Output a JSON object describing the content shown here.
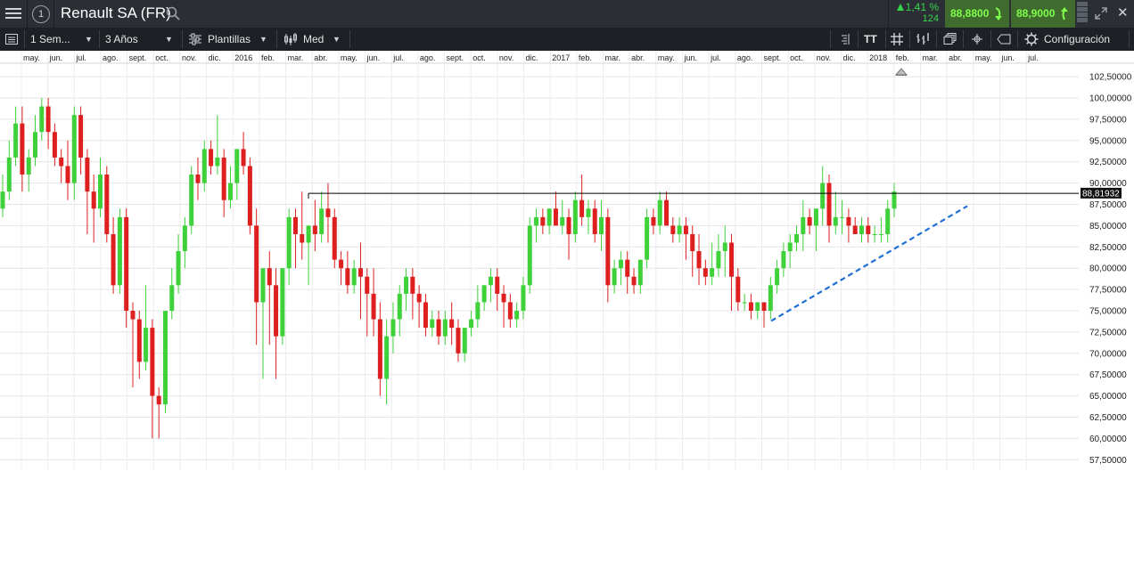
{
  "header": {
    "instrument_title": "Renault SA (FR)",
    "info_glyph": "1",
    "change_percent": "1,41 %",
    "change_count": "124",
    "sell_price": "88,8800",
    "buy_price": "88,9000",
    "icons": [
      "menu-icon",
      "info-icon",
      "search-icon",
      "arrow-down-icon",
      "arrow-up-icon",
      "market-depth-icon",
      "expand-icon",
      "close-icon"
    ]
  },
  "toolbar": {
    "interval": "1 Sem...",
    "range": "3 Años",
    "templates": "Plantillas",
    "chart_style": "Med",
    "settings": "Configuración",
    "text_tool": "TT",
    "icons": [
      "sidebar-icon",
      "templates-icon",
      "candles-icon",
      "indent-icon",
      "text-icon",
      "grid-icon",
      "bars-icon",
      "layers-icon",
      "crosshair-icon",
      "tag-icon",
      "gear-icon"
    ]
  },
  "colors": {
    "up": "#3fd13a",
    "down": "#dd1f1f",
    "trendline": "#1f6fd6",
    "header_bg": "#2b2f35",
    "toolbar_bg": "#1d2024",
    "price_green": "#7fff4a"
  },
  "chart_data": {
    "type": "candlestick",
    "interval": "weekly",
    "current_price_label": "88,81932",
    "current_price": 88.81932,
    "y_ticks": [
      "102,50000",
      "100,00000",
      "97,50000",
      "95,00000",
      "92,50000",
      "90,00000",
      "87,50000",
      "85,00000",
      "82,50000",
      "80,00000",
      "77,50000",
      "75,00000",
      "72,50000",
      "70,00000",
      "67,50000",
      "65,00000",
      "62,50000",
      "60,00000",
      "57,50000"
    ],
    "y_tick_values": [
      102.5,
      100,
      97.5,
      95,
      92.5,
      90,
      87.5,
      85,
      82.5,
      80,
      77.5,
      75,
      72.5,
      70,
      67.5,
      65,
      62.5,
      60,
      57.5
    ],
    "x_ticks": [
      "may.",
      "jun.",
      "jul.",
      "ago.",
      "sept.",
      "oct.",
      "nov.",
      "dic.",
      "2016",
      "feb.",
      "mar.",
      "abr.",
      "may.",
      "jun.",
      "jul.",
      "ago.",
      "sept.",
      "oct.",
      "nov.",
      "dic.",
      "2017",
      "feb.",
      "mar.",
      "abr.",
      "may.",
      "jun.",
      "jul.",
      "ago.",
      "sept.",
      "oct.",
      "nov.",
      "dic.",
      "2018",
      "feb.",
      "mar.",
      "abr.",
      "may.",
      "jun.",
      "jul."
    ],
    "resistance_level": 88.8,
    "trendline": {
      "from": {
        "date": "2017-08-21",
        "price": 73.8
      },
      "to": {
        "date": "2018-03-12",
        "price": 87.3
      }
    },
    "candles": [
      [
        87,
        91,
        86,
        89
      ],
      [
        89,
        95,
        88,
        93
      ],
      [
        93,
        99,
        92,
        97
      ],
      [
        97,
        99,
        89,
        91
      ],
      [
        91,
        94,
        89,
        93
      ],
      [
        93,
        98,
        92,
        96
      ],
      [
        96,
        100,
        95,
        99
      ],
      [
        99,
        100,
        94,
        96
      ],
      [
        96,
        97,
        92,
        93
      ],
      [
        93,
        94,
        90,
        92
      ],
      [
        92,
        95,
        88,
        90
      ],
      [
        90,
        99,
        88,
        98
      ],
      [
        98,
        99,
        91,
        93
      ],
      [
        93,
        94,
        84,
        89
      ],
      [
        89,
        91,
        83,
        87
      ],
      [
        87,
        93,
        86,
        91
      ],
      [
        91,
        92,
        83,
        84
      ],
      [
        84,
        86,
        77,
        78
      ],
      [
        78,
        87,
        77,
        86
      ],
      [
        86,
        87,
        73,
        75
      ],
      [
        75,
        76,
        66,
        74
      ],
      [
        74,
        75,
        67,
        69
      ],
      [
        69,
        78,
        68,
        73
      ],
      [
        73,
        74,
        60,
        65
      ],
      [
        65,
        66,
        60,
        64
      ],
      [
        64,
        71,
        63,
        75
      ],
      [
        75,
        80,
        74,
        78
      ],
      [
        78,
        84,
        77,
        82
      ],
      [
        82,
        86,
        80,
        85
      ],
      [
        85,
        92,
        84,
        91
      ],
      [
        91,
        93,
        88,
        90
      ],
      [
        90,
        95,
        89,
        94
      ],
      [
        94,
        95,
        91,
        92
      ],
      [
        92,
        98,
        91,
        93
      ],
      [
        93,
        94,
        86,
        88
      ],
      [
        88,
        92,
        87,
        90
      ],
      [
        90,
        93,
        88,
        94
      ],
      [
        94,
        96,
        91,
        92
      ],
      [
        92,
        93,
        84,
        85
      ],
      [
        85,
        87,
        71,
        76
      ],
      [
        76,
        79,
        67,
        80
      ],
      [
        80,
        82,
        71,
        78
      ],
      [
        78,
        80,
        67,
        72
      ],
      [
        72,
        80,
        71,
        80
      ],
      [
        80,
        87,
        78,
        86
      ],
      [
        86,
        87,
        80,
        84
      ],
      [
        84,
        89,
        81,
        83
      ],
      [
        83,
        85,
        78,
        85
      ],
      [
        85,
        88,
        82,
        84
      ],
      [
        84,
        89,
        83,
        87
      ],
      [
        87,
        90,
        83,
        86
      ],
      [
        86,
        87,
        80,
        81
      ],
      [
        81,
        82,
        78,
        80
      ],
      [
        80,
        82,
        77,
        78
      ],
      [
        78,
        81,
        77,
        80
      ],
      [
        80,
        83,
        74,
        79
      ],
      [
        79,
        80,
        72,
        77
      ],
      [
        77,
        80,
        72,
        74
      ],
      [
        74,
        76,
        65,
        67
      ],
      [
        67,
        74,
        64,
        72
      ],
      [
        72,
        76,
        70,
        74
      ],
      [
        74,
        78,
        72,
        77
      ],
      [
        77,
        80,
        75,
        79
      ],
      [
        79,
        80,
        74,
        77
      ],
      [
        77,
        78,
        73,
        76
      ],
      [
        76,
        77,
        72,
        73
      ],
      [
        73,
        75,
        72,
        74
      ],
      [
        74,
        75,
        71,
        72
      ],
      [
        72,
        75,
        71,
        74
      ],
      [
        74,
        76,
        71,
        73
      ],
      [
        73,
        74,
        69,
        70
      ],
      [
        70,
        73,
        69,
        73
      ],
      [
        73,
        75,
        72,
        74
      ],
      [
        74,
        78,
        73,
        76
      ],
      [
        76,
        78,
        75,
        78
      ],
      [
        78,
        80,
        76,
        79
      ],
      [
        79,
        80,
        75,
        77
      ],
      [
        77,
        78,
        73,
        76
      ],
      [
        76,
        77,
        73,
        74
      ],
      [
        74,
        76,
        73,
        75
      ],
      [
        75,
        79,
        74,
        78
      ],
      [
        78,
        86,
        77,
        85
      ],
      [
        85,
        87,
        83,
        86
      ],
      [
        86,
        87,
        84,
        85
      ],
      [
        85,
        87,
        84,
        87
      ],
      [
        87,
        89,
        86,
        85
      ],
      [
        85,
        88,
        84,
        86
      ],
      [
        86,
        87,
        81,
        84
      ],
      [
        84,
        89,
        83,
        88
      ],
      [
        88,
        91,
        85,
        86
      ],
      [
        86,
        88,
        84,
        87
      ],
      [
        87,
        88,
        83,
        84
      ],
      [
        84,
        88,
        82,
        86
      ],
      [
        86,
        87,
        76,
        78
      ],
      [
        78,
        81,
        77,
        80
      ],
      [
        80,
        82,
        78,
        81
      ],
      [
        81,
        82,
        77,
        79
      ],
      [
        79,
        80,
        77,
        78
      ],
      [
        78,
        81,
        77,
        81
      ],
      [
        81,
        87,
        80,
        86
      ],
      [
        86,
        87,
        84,
        85
      ],
      [
        85,
        89,
        84,
        88
      ],
      [
        88,
        89,
        85,
        85
      ],
      [
        85,
        86,
        83,
        84
      ],
      [
        84,
        86,
        83,
        85
      ],
      [
        85,
        86,
        81,
        84
      ],
      [
        84,
        85,
        79,
        82
      ],
      [
        82,
        84,
        78,
        80
      ],
      [
        80,
        81,
        78,
        79
      ],
      [
        79,
        83,
        78,
        80
      ],
      [
        80,
        84,
        79,
        82
      ],
      [
        82,
        85,
        79,
        83
      ],
      [
        83,
        84,
        75,
        79
      ],
      [
        79,
        80,
        75,
        76
      ],
      [
        76,
        77,
        75,
        76
      ],
      [
        76,
        77,
        74,
        75
      ],
      [
        75,
        76,
        74,
        76
      ],
      [
        76,
        76,
        73,
        75
      ],
      [
        75,
        79,
        74,
        78
      ],
      [
        78,
        81,
        77,
        80
      ],
      [
        80,
        83,
        79,
        82
      ],
      [
        82,
        84,
        80,
        83
      ],
      [
        83,
        85,
        82,
        84
      ],
      [
        84,
        88,
        82,
        86
      ],
      [
        86,
        87,
        84,
        85
      ],
      [
        85,
        87,
        82,
        87
      ],
      [
        87,
        92,
        85,
        90
      ],
      [
        90,
        91,
        83,
        85
      ],
      [
        85,
        89,
        84,
        86
      ],
      [
        86,
        88,
        84,
        86
      ],
      [
        86,
        87,
        83,
        85
      ],
      [
        85,
        86,
        84,
        84
      ],
      [
        84,
        86,
        83,
        85
      ],
      [
        85,
        86,
        83,
        84
      ],
      [
        84,
        85,
        83,
        84
      ],
      [
        84,
        86,
        83,
        84
      ],
      [
        84,
        88,
        83,
        87
      ],
      [
        87,
        90,
        86,
        89
      ]
    ]
  }
}
